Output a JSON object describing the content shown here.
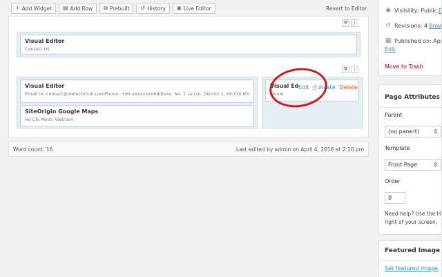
{
  "toolbar": {
    "add_widget": "Add Widget",
    "add_row": "Add Row",
    "prebuilt": "Prebuilt",
    "history": "History",
    "live_editor": "Live Editor",
    "revert": "Revert to Editor"
  },
  "rows": [
    {
      "widgets": [
        {
          "title": "Visual Editor",
          "desc": "Contact Us"
        }
      ]
    },
    {
      "col1": [
        {
          "title": "Visual Editor",
          "desc": "Email to: contact@vietechclub.comPhone: +84 xxxxxxxxAddress: No. 2 Le Loi, District 1, Ho Chi Minh."
        },
        {
          "title": "SiteOrigin Google Maps",
          "desc": "Ho Chi Minh, Vietnam"
        }
      ],
      "col2": [
        {
          "title": "Visual Ed",
          "desc": "Visual",
          "actions": {
            "edit": "Edit",
            "duplicate": "Duplicate",
            "delete": "Delete"
          }
        }
      ]
    }
  ],
  "status": {
    "word_count": "Word count: 16",
    "last_edited": "Last edited by admin on April 4, 2016 at 2:10 pm"
  },
  "sidebar": {
    "visibility_label": "Visibility: Public",
    "visibility_link": "Ed",
    "revisions_label": "Revisions: 4",
    "revisions_link": "Brow",
    "published_label": "Published on: Apr",
    "published_link": "Edit",
    "trash": "Move to Trash",
    "page_attributes": {
      "title": "Page Attributes",
      "parent_label": "Parent",
      "parent_value": "(no parent)",
      "template_label": "Template",
      "template_value": "Front Page",
      "order_label": "Order",
      "order_value": "0",
      "help_line1": "Need help? Use the H",
      "help_line2": "right of your screen."
    },
    "featured_image": {
      "title": "Featured Image",
      "link": "Set featured image"
    }
  },
  "colors": {
    "link": "#2e8fc4",
    "delete": "#d54e21",
    "trash": "#aa0000",
    "annotation": "#d01a1a"
  }
}
